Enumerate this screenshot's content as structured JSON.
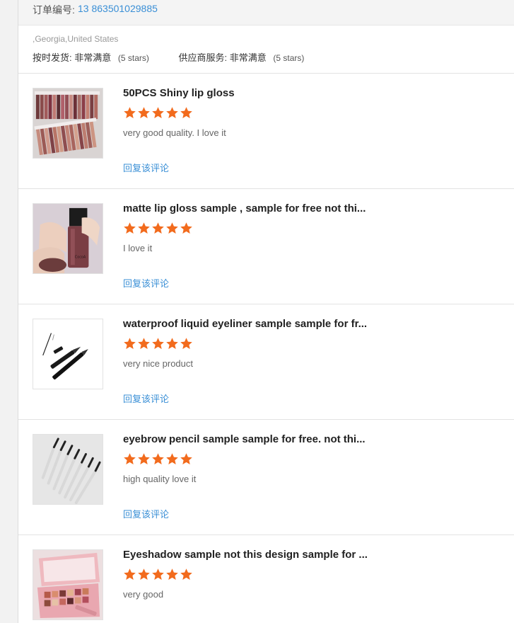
{
  "order": {
    "label": "订单编号:",
    "number": "13       863501029885"
  },
  "address": "       ,Georgia,United States",
  "ratings": [
    {
      "label": "按时发货:",
      "value": "非常满意",
      "stars_note": "(5 stars)"
    },
    {
      "label": "供应商服务:",
      "value": "非常满意",
      "stars_note": "(5 stars)"
    }
  ],
  "reply_label": "回复该评论",
  "star_color": "#f26b1d",
  "reviews": [
    {
      "title": "50PCS Shiny lip gloss",
      "rating": 5,
      "comment": "very good quality. I love it",
      "image": "lip-gloss-set-photo"
    },
    {
      "title": "matte lip gloss sample , sample for free not thi...",
      "rating": 5,
      "comment": "I love it",
      "image": "matte-lip-gloss-hand-photo"
    },
    {
      "title": "waterproof liquid eyeliner sample sample for fr...",
      "rating": 5,
      "comment": "very nice product",
      "image": "eyeliner-pens-photo"
    },
    {
      "title": "eyebrow pencil sample sample for free. not thi...",
      "rating": 5,
      "comment": "high quality love it",
      "image": "eyebrow-pencils-photo"
    },
    {
      "title": "Eyeshadow sample not this design sample for ...",
      "rating": 5,
      "comment": "very good",
      "image": "eyeshadow-palette-photo"
    }
  ]
}
